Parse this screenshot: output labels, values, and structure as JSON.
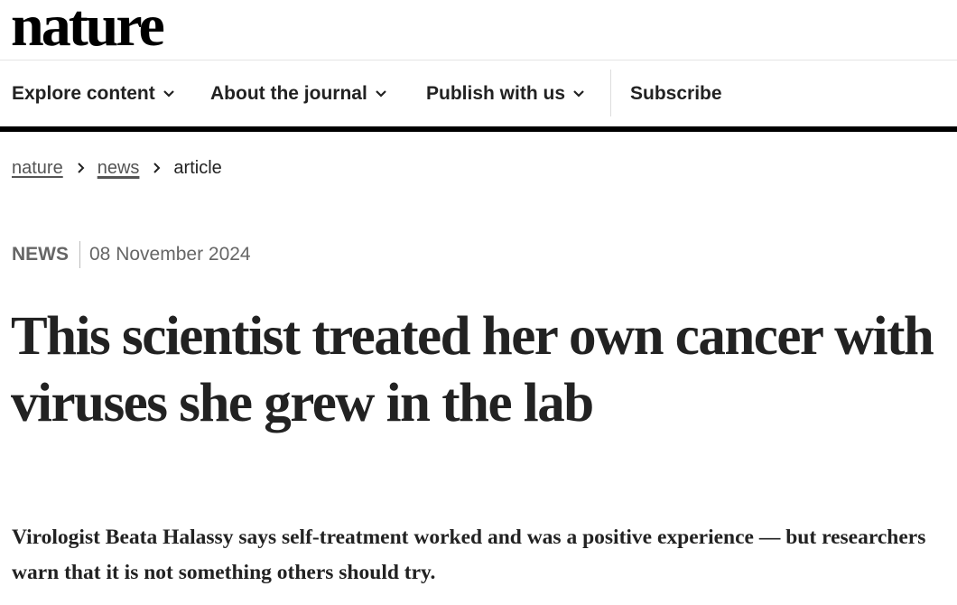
{
  "header": {
    "logo_text": "nature"
  },
  "nav": {
    "items": [
      {
        "label": "Explore content",
        "has_dropdown": true
      },
      {
        "label": "About the journal",
        "has_dropdown": true
      },
      {
        "label": "Publish with us",
        "has_dropdown": true
      }
    ],
    "subscribe_label": "Subscribe"
  },
  "breadcrumb": {
    "items": [
      {
        "label": "nature",
        "link": true
      },
      {
        "label": "news",
        "link": true
      },
      {
        "label": "article",
        "link": false
      }
    ]
  },
  "article": {
    "type": "NEWS",
    "date": "08 November 2024",
    "title": "This scientist treated her own cancer with viruses she grew in the lab",
    "standfirst": "Virologist Beata Halassy says self-treatment worked and was a positive experience — but researchers warn that it is not something others should try."
  },
  "colors": {
    "text": "#222222",
    "muted": "#666666",
    "rule": "#000000"
  }
}
